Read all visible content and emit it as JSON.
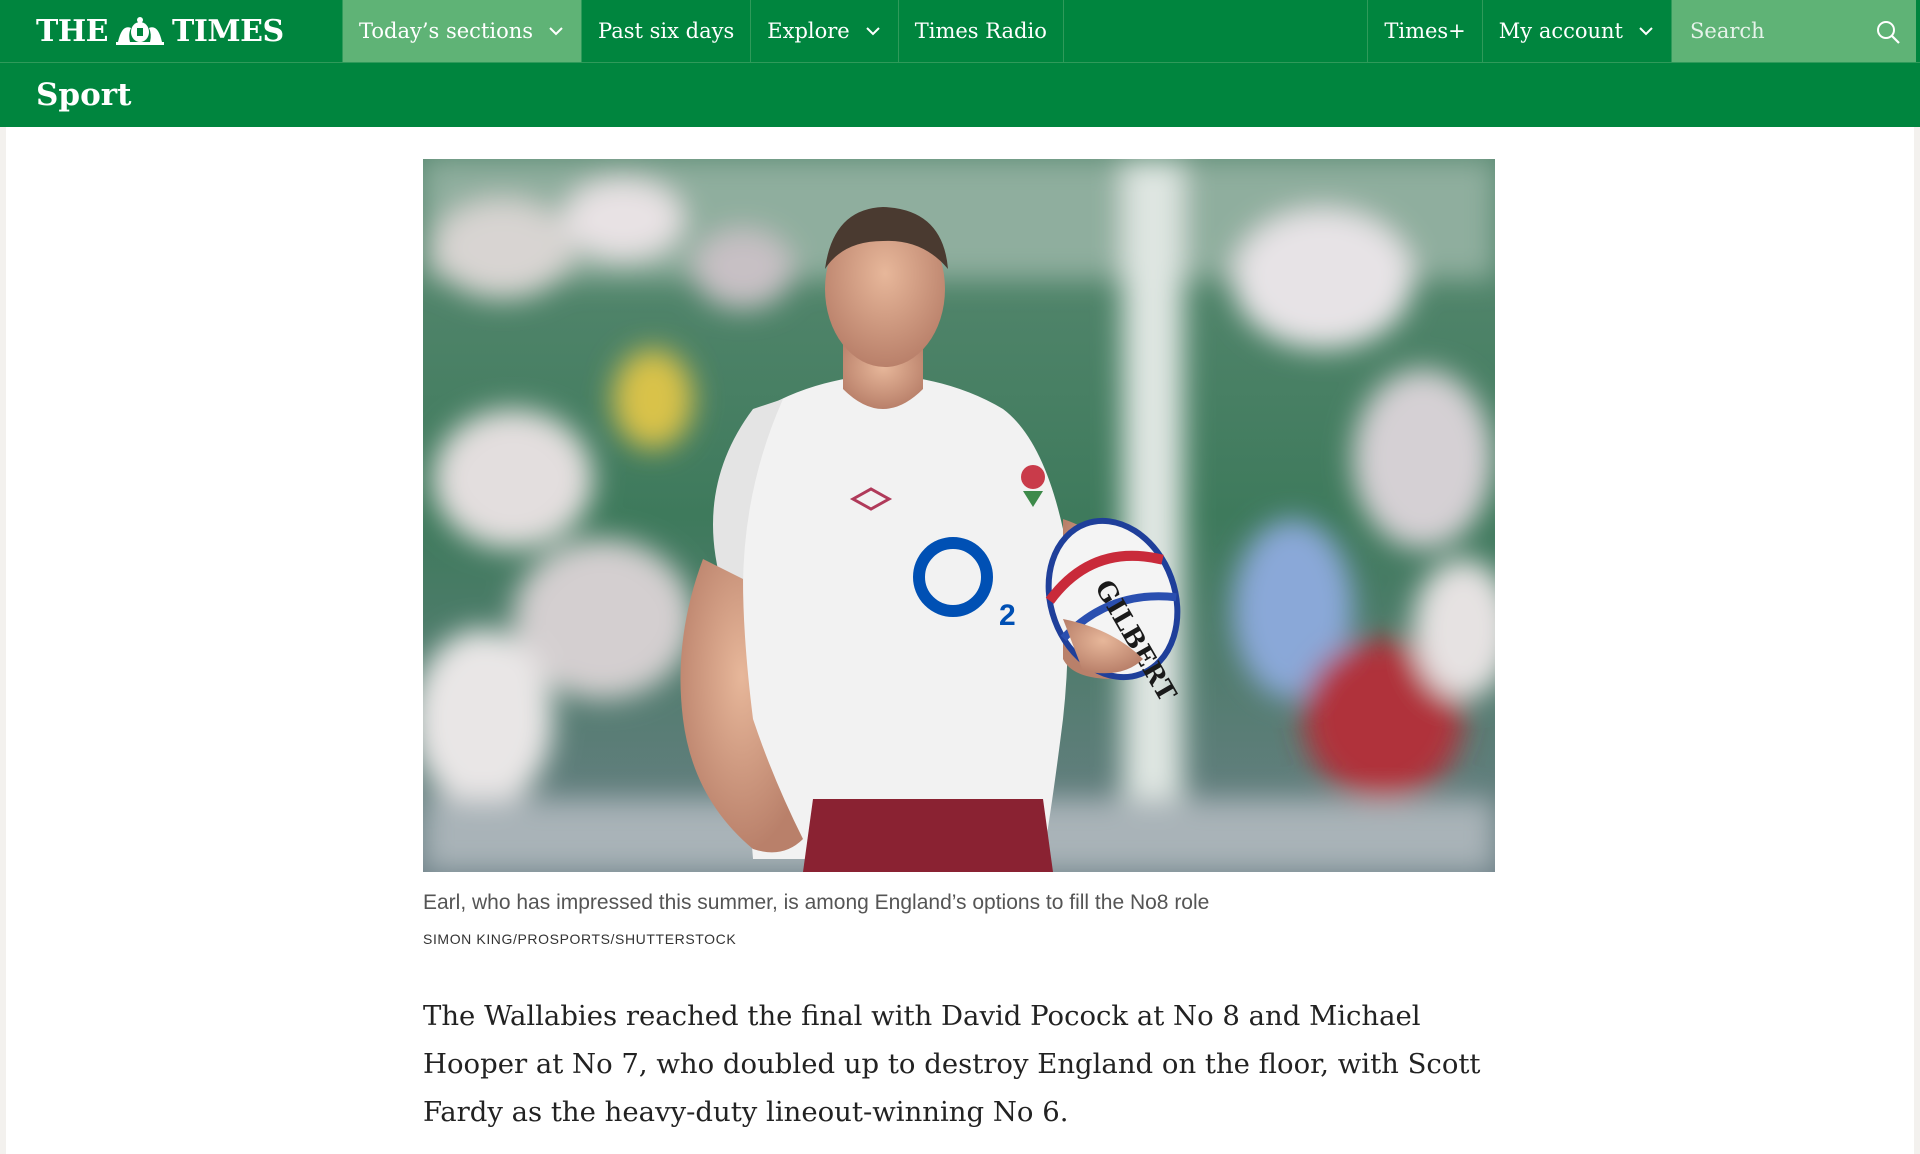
{
  "header": {
    "logo_left": "THE",
    "logo_right": "TIMES",
    "nav": [
      {
        "label": "Today’s sections",
        "has_dropdown": true,
        "active": true
      },
      {
        "label": "Past six days",
        "has_dropdown": false,
        "active": false
      },
      {
        "label": "Explore",
        "has_dropdown": true,
        "active": false
      },
      {
        "label": "Times Radio",
        "has_dropdown": false,
        "active": false
      }
    ],
    "right_nav": [
      {
        "label": "Times+",
        "has_dropdown": false
      },
      {
        "label": "My account",
        "has_dropdown": true
      }
    ],
    "search": {
      "placeholder": "Search",
      "icon": "search-icon"
    }
  },
  "section": {
    "title": "Sport"
  },
  "article": {
    "image": {
      "icon": "rugby-player-photo"
    },
    "caption": "Earl, who has impressed this summer, is among England’s options to fill the No8 role",
    "credit": "SIMON KING/PROSPORTS/SHUTTERSTOCK",
    "paragraph": "The Wallabies reached the final with David Pocock at No 8 and Michael Hooper at No 7, who doubled up to destroy England on the floor, with Scott Fardy as the heavy-duty lineout-winning No 6."
  },
  "colors": {
    "brand_green": "#00853e",
    "active_green": "#5fb376"
  }
}
